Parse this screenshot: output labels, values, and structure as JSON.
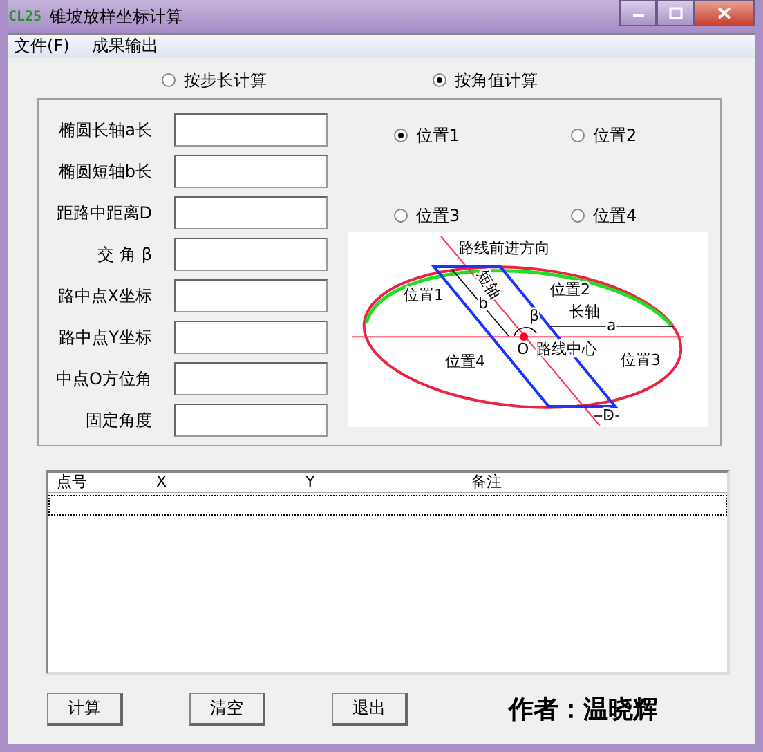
{
  "window": {
    "title": "锥坡放样坐标计算",
    "logo": "CL25"
  },
  "menu": [
    {
      "label": "文件(F)"
    },
    {
      "label": "成果输出"
    }
  ],
  "mode_options": [
    {
      "label": "按步长计算",
      "selected": false
    },
    {
      "label": "按角值计算",
      "selected": true
    }
  ],
  "fields": [
    {
      "label": "椭圆长轴a长"
    },
    {
      "label": "椭圆短轴b长"
    },
    {
      "label": "距路中距离D"
    },
    {
      "label": "交 角 β"
    },
    {
      "label": "路中点X坐标"
    },
    {
      "label": "路中点Y坐标"
    },
    {
      "label": "中点O方位角"
    },
    {
      "label": "固定角度"
    }
  ],
  "position_options": [
    {
      "label": "位置1",
      "selected": true
    },
    {
      "label": "位置2",
      "selected": false
    },
    {
      "label": "位置3",
      "selected": false
    },
    {
      "label": "位置4",
      "selected": false
    }
  ],
  "diagram_labels": [
    "路线前进方向",
    "短轴",
    "位置1",
    "位置2",
    "b",
    "β",
    "长轴",
    "a",
    "O",
    "路线中心",
    "位置4",
    "位置3",
    "D"
  ],
  "table": {
    "columns": [
      "点号",
      "X",
      "Y",
      "备注"
    ]
  },
  "buttons": [
    "计算",
    "清空",
    "退出"
  ],
  "author": "作者：温晓辉"
}
